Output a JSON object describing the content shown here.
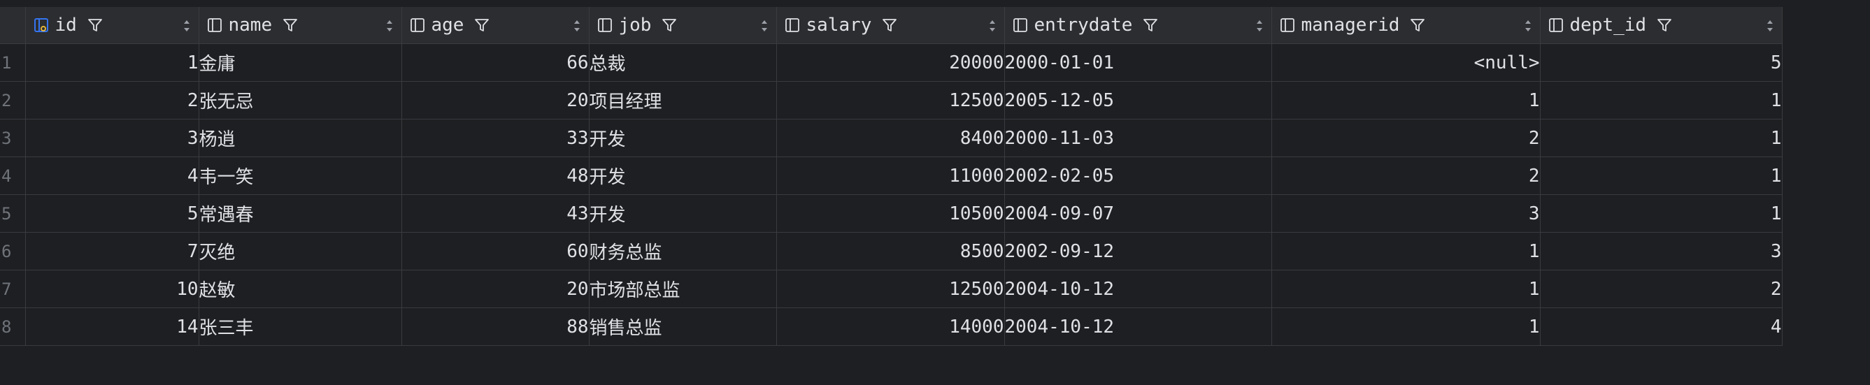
{
  "columns": [
    {
      "label": "id",
      "align": "num",
      "icon": "key-column-icon"
    },
    {
      "label": "name",
      "align": "txt",
      "icon": "column-icon"
    },
    {
      "label": "age",
      "align": "num",
      "icon": "column-icon"
    },
    {
      "label": "job",
      "align": "txt",
      "icon": "column-icon"
    },
    {
      "label": "salary",
      "align": "num",
      "icon": "column-icon"
    },
    {
      "label": "entrydate",
      "align": "txt",
      "icon": "column-icon"
    },
    {
      "label": "managerid",
      "align": "num",
      "icon": "column-icon"
    },
    {
      "label": "dept_id",
      "align": "num",
      "icon": "column-icon"
    }
  ],
  "rows": [
    {
      "n": "1",
      "cells": [
        "1",
        "金庸",
        "66",
        "总裁",
        "20000",
        "2000-01-01",
        "<null>",
        "5"
      ]
    },
    {
      "n": "2",
      "cells": [
        "2",
        "张无忌",
        "20",
        "项目经理",
        "12500",
        "2005-12-05",
        "1",
        "1"
      ]
    },
    {
      "n": "3",
      "cells": [
        "3",
        "杨逍",
        "33",
        "开发",
        "8400",
        "2000-11-03",
        "2",
        "1"
      ]
    },
    {
      "n": "4",
      "cells": [
        "4",
        "韦一笑",
        "48",
        "开发",
        "11000",
        "2002-02-05",
        "2",
        "1"
      ]
    },
    {
      "n": "5",
      "cells": [
        "5",
        "常遇春",
        "43",
        "开发",
        "10500",
        "2004-09-07",
        "3",
        "1"
      ]
    },
    {
      "n": "6",
      "cells": [
        "7",
        "灭绝",
        "60",
        "财务总监",
        "8500",
        "2002-09-12",
        "1",
        "3"
      ]
    },
    {
      "n": "7",
      "cells": [
        "10",
        "赵敏",
        "20",
        "市场部总监",
        "12500",
        "2004-10-12",
        "1",
        "2"
      ]
    },
    {
      "n": "8",
      "cells": [
        "14",
        "张三丰",
        "88",
        "销售总监",
        "14000",
        "2004-10-12",
        "1",
        "4"
      ]
    }
  ],
  "null_display": "<null>",
  "colors": {
    "background": "#1e1f22",
    "header_bg": "#2b2d30",
    "grid_line": "#393b40",
    "text": "#dfe1e5",
    "muted": "#6f737a",
    "key_icon": "#3574f0"
  }
}
